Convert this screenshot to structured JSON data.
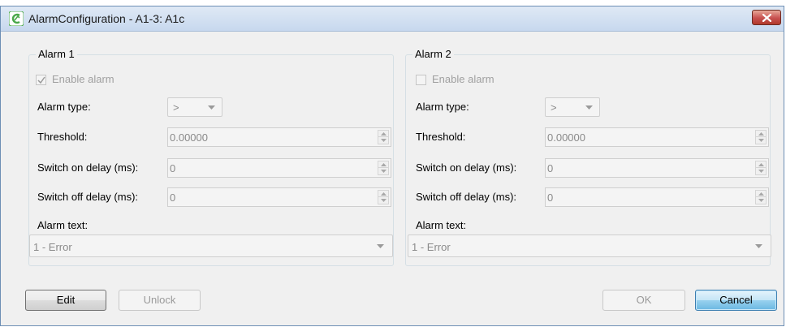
{
  "window": {
    "title": "AlarmConfiguration - A1-3: A1c",
    "accent": "#4aa84a"
  },
  "alarms": [
    {
      "legend": "Alarm 1",
      "enable_label": "Enable alarm",
      "enabled_checked": true,
      "type_label": "Alarm type:",
      "type_value": ">",
      "threshold_label": "Threshold:",
      "threshold_value": "0.00000",
      "on_delay_label": "Switch on delay (ms):",
      "on_delay_value": "0",
      "off_delay_label": "Switch off delay (ms):",
      "off_delay_value": "0",
      "text_label": "Alarm text:",
      "text_value": "1 - Error"
    },
    {
      "legend": "Alarm 2",
      "enable_label": "Enable alarm",
      "enabled_checked": false,
      "type_label": "Alarm type:",
      "type_value": ">",
      "threshold_label": "Threshold:",
      "threshold_value": "0.00000",
      "on_delay_label": "Switch on delay (ms):",
      "on_delay_value": "0",
      "off_delay_label": "Switch off delay (ms):",
      "off_delay_value": "0",
      "text_label": "Alarm text:",
      "text_value": "1 - Error"
    }
  ],
  "buttons": {
    "edit": "Edit",
    "unlock": "Unlock",
    "ok": "OK",
    "cancel": "Cancel"
  }
}
